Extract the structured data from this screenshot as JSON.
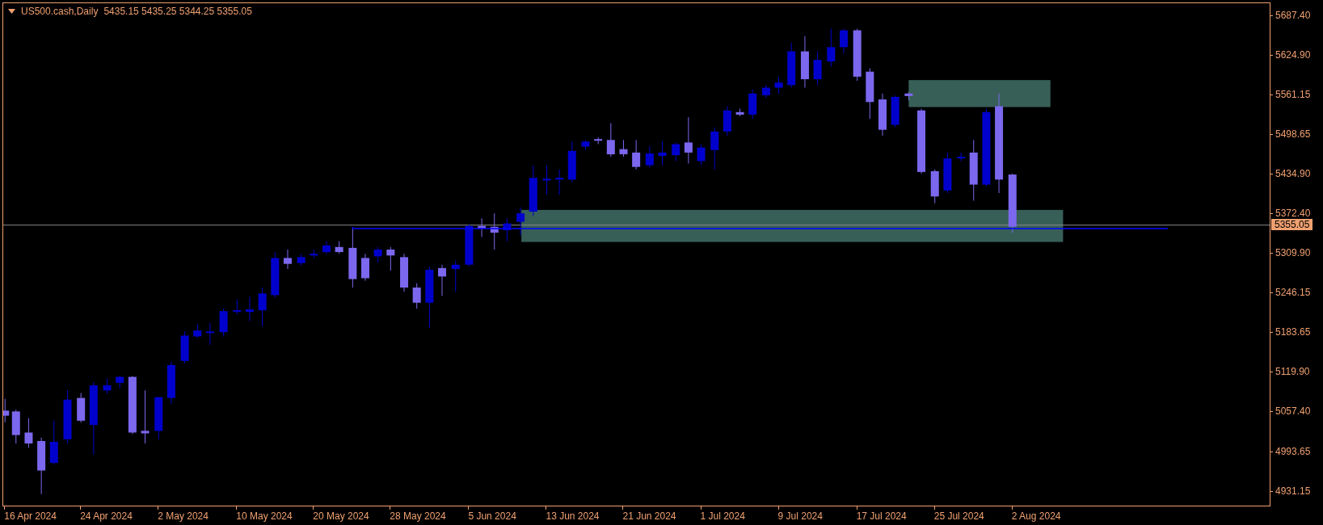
{
  "header": {
    "symbol": "US500.cash,Daily",
    "ohlc": "5435.15 5435.25 5344.25 5355.05"
  },
  "price_axis": {
    "ticks": [
      "5687.40",
      "5624.90",
      "5561.15",
      "5498.65",
      "5434.90",
      "5372.40",
      "5309.90",
      "5246.15",
      "5183.65",
      "5119.90",
      "5057.40",
      "4993.65",
      "4931.15"
    ],
    "current_price": "5355.05"
  },
  "time_axis": {
    "ticks": [
      "16 Apr 2024",
      "24 Apr 2024",
      "2 May 2024",
      "10 May 2024",
      "20 May 2024",
      "28 May 2024",
      "5 Jun 2024",
      "13 Jun 2024",
      "21 Jun 2024",
      "1 Jul 2024",
      "9 Jul 2024",
      "17 Jul 2024",
      "25 Jul 2024",
      "2 Aug 2024"
    ]
  }
}
